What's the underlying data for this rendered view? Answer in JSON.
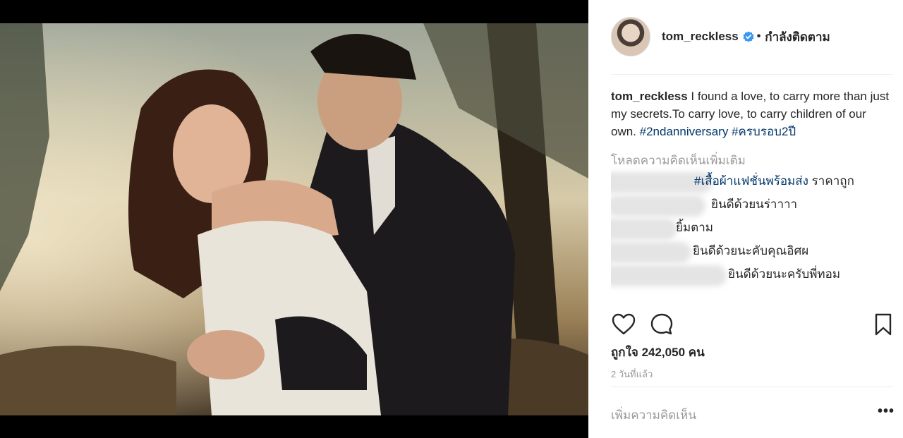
{
  "post": {
    "username": "tom_reckless",
    "follow_status": "กำลังติดตาม",
    "separator": "•"
  },
  "caption": {
    "username": "tom_reckless",
    "text": " I found a love, to carry more than just my secrets.To carry love, to carry children of our own. ",
    "hashtag1": "#2ndanniversary",
    "hashtag2": "#ครบรอบ2ปี"
  },
  "load_more": "โหลดความคิดเห็นเพิ่มเติม",
  "comments": [
    {
      "hashtag": "#เสื้อผ้าแฟชั่นพร้อมส่ง",
      "text": " ราคาถูก"
    },
    {
      "hashtag": "",
      "text": "ยินดีด้วยนร่าาาา"
    },
    {
      "hashtag": "",
      "text": "ยิ้มตาม"
    },
    {
      "hashtag": "",
      "text": "ยินดีด้วยนะคับคุณอิศผ"
    },
    {
      "hashtag": "",
      "text": "ยินดีด้วยนะครับพี่ทอม"
    }
  ],
  "likes": "ถูกใจ 242,050 คน",
  "time_ago": "2 วันที่แล้ว",
  "add_comment_placeholder": "เพิ่มความคิดเห็น",
  "more_options": "•••",
  "icons": {
    "like": "heart-icon",
    "comment": "comment-bubble-icon",
    "save": "bookmark-icon",
    "verified": "verified-badge-icon"
  },
  "colors": {
    "link": "#003569",
    "secondary_text": "#999999",
    "verified": "#3897f0"
  }
}
